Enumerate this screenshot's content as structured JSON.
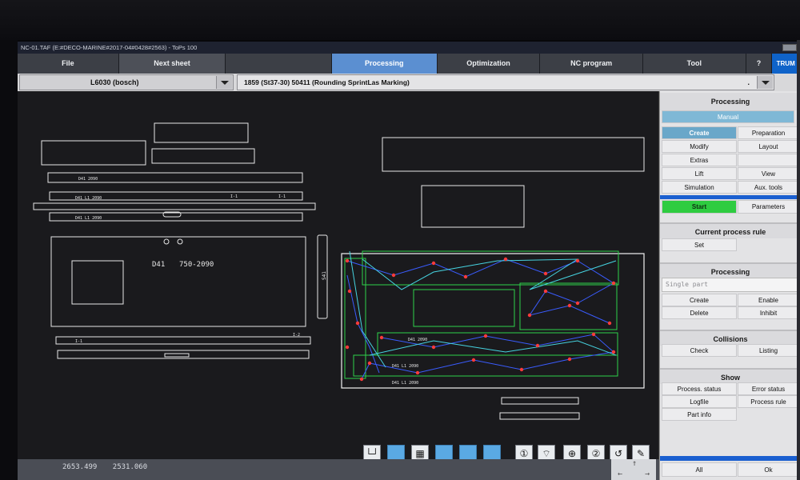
{
  "window": {
    "title": "NC-01.TAF  (E:#DECO-MARINE#2017-04#0428#2563) - ToPs 100"
  },
  "menu": {
    "items": [
      {
        "label": "File",
        "style": "normal"
      },
      {
        "label": "Next sheet",
        "style": "alt"
      },
      {
        "label": "",
        "style": "normal"
      },
      {
        "label": "Processing",
        "style": "active"
      },
      {
        "label": "Optimization",
        "style": "normal"
      },
      {
        "label": "NC program",
        "style": "normal"
      },
      {
        "label": "Tool",
        "style": "normal"
      },
      {
        "label": "?",
        "style": "normal"
      },
      {
        "label": "TRUM",
        "style": "brand"
      }
    ]
  },
  "info": {
    "machine": "L6030 (bosch)",
    "sheet": "1859 (St37-30)   50411 (Rounding SprintLas Marking)",
    "sheet_dot": "."
  },
  "drawing": {
    "labels": {
      "d41_text": "D41",
      "range_text": "750-2090",
      "part_a": "D41  2090",
      "part_b": "D41  L1  2090",
      "part_c": "D41  L1  2090",
      "small_a": "I-1",
      "small_b": "I-1",
      "small_c": "I-1",
      "small_d": "I-2",
      "nest_a": "D41 2090",
      "nest_b": "D41 L1 2090",
      "nest_c": "D41 L1 2090",
      "vert_label": "S41"
    },
    "colors": {
      "background": "#1a1a1d",
      "outline": "#e6e6e6",
      "sheet": "#f2f2f2",
      "green": "#2fd14a",
      "cyan": "#46d3e0",
      "blue": "#3a5cff",
      "red": "#ff3b3b"
    }
  },
  "status": {
    "x": "2653.499",
    "y": "2531.060"
  },
  "toolbar": {
    "tools": [
      {
        "icon": "corner-icon",
        "glyph": "└┘"
      },
      {
        "icon": "blank-icon",
        "glyph": ""
      },
      {
        "icon": "grid-icon",
        "glyph": "▦"
      },
      {
        "icon": "blank-icon",
        "glyph": ""
      },
      {
        "icon": "blank-icon",
        "glyph": ""
      },
      {
        "icon": "blank-icon",
        "glyph": ""
      },
      {
        "icon": "zoom-1-icon",
        "glyph": "①"
      },
      {
        "icon": "zoom-fit-icon",
        "glyph": "⌔"
      },
      {
        "icon": "zoom-window-icon",
        "glyph": "⊕"
      },
      {
        "icon": "zoom-2-icon",
        "glyph": "②"
      },
      {
        "icon": "zoom-back-icon",
        "glyph": "↺"
      },
      {
        "icon": "pencil-icon",
        "glyph": "✎"
      }
    ]
  },
  "panel": {
    "processing_title": "Processing",
    "manual_tab": "Manual",
    "create": "Create",
    "preparation": "Preparation",
    "modify": "Modify",
    "layout": "Layout",
    "extras": "Extras",
    "lift": "Lift",
    "view": "View",
    "simulation": "Simulation",
    "aux_tools": "Aux. tools",
    "start": "Start",
    "parameters": "Parameters",
    "current_rule_title": "Current process rule",
    "set": "Set",
    "processing_sub_title": "Processing",
    "single_part": "Single part",
    "create2": "Create",
    "enable": "Enable",
    "delete": "Delete",
    "inhibit": "Inhibit",
    "collisions_title": "Collisions",
    "check": "Check",
    "listing": "Listing",
    "show_title": "Show",
    "process_status": "Process. status",
    "error_status": "Error status",
    "logfile": "Logfile",
    "process_rule": "Process rule",
    "part_info": "Part info",
    "all": "All",
    "ok": "Ok"
  }
}
